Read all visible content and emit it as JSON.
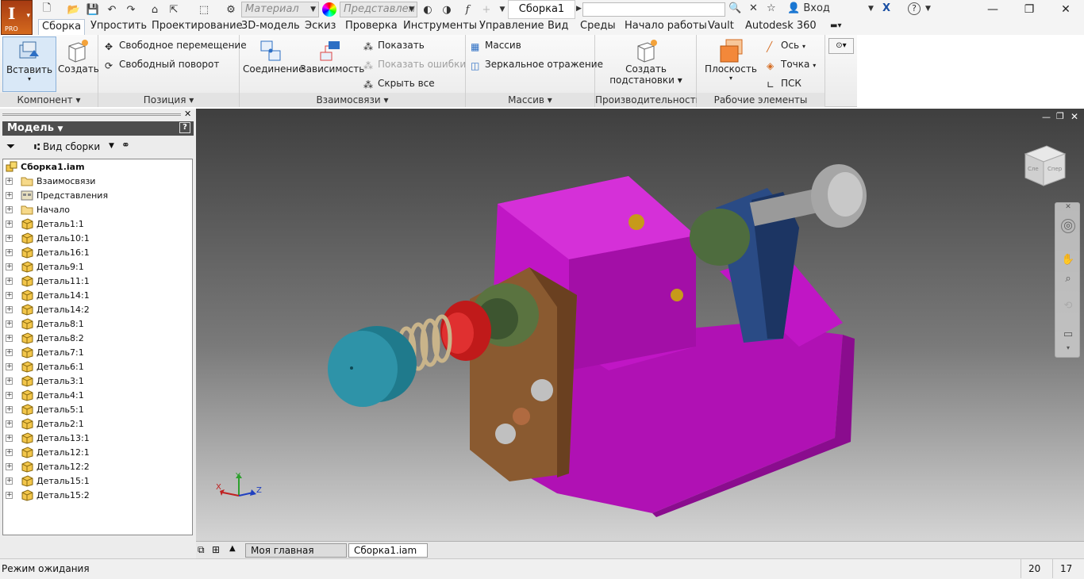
{
  "app": {
    "logo_text": "I",
    "edition": "PRO"
  },
  "qat": {
    "material_placeholder": "Материал",
    "appearance_placeholder": "Представлен",
    "document_title": "Сборка1",
    "sign_in": "Вход",
    "search_value": ""
  },
  "tabs": [
    "Сборка",
    "Упростить",
    "Проектирование",
    "3D-модель",
    "Эскиз",
    "Проверка",
    "Инструменты",
    "Управление",
    "Вид",
    "Среды",
    "Начало работы",
    "Vault",
    "Autodesk 360"
  ],
  "ribbon": {
    "component": {
      "title": "Компонент",
      "insert": "Вставить",
      "create": "Создать"
    },
    "position": {
      "title": "Позиция",
      "free_move": "Свободное перемещение",
      "free_rotate": "Свободный поворот"
    },
    "relations": {
      "title": "Взаимосвязи",
      "joint": "Соединение",
      "constraint": "Зависимость",
      "show": "Показать",
      "show_errors": "Показать ошибки",
      "hide_all": "Скрыть все"
    },
    "pattern": {
      "title": "Массив",
      "pattern": "Массив",
      "mirror": "Зеркальное отражение"
    },
    "productivity": {
      "title": "Производительность",
      "substitutes_line1": "Создать",
      "substitutes_line2": "подстановки"
    },
    "work_features": {
      "title": "Рабочие элементы",
      "plane": "Плоскость",
      "axis": "Ось",
      "point": "Точка",
      "ucs": "ПСК"
    }
  },
  "browser": {
    "title": "Модель",
    "view": "Вид сборки",
    "root": "Сборка1.iam",
    "folders": [
      "Взаимосвязи",
      "Представления",
      "Начало"
    ],
    "parts": [
      "Деталь1:1",
      "Деталь10:1",
      "Деталь16:1",
      "Деталь9:1",
      "Деталь11:1",
      "Деталь14:1",
      "Деталь14:2",
      "Деталь8:1",
      "Деталь8:2",
      "Деталь7:1",
      "Деталь6:1",
      "Деталь3:1",
      "Деталь4:1",
      "Деталь5:1",
      "Деталь2:1",
      "Деталь13:1",
      "Деталь12:1",
      "Деталь12:2",
      "Деталь15:1",
      "Деталь15:2"
    ]
  },
  "viewport": {
    "axis_x": "X",
    "axis_y": "Y",
    "axis_z": "Z",
    "viewcube_left": "Сле",
    "viewcube_front": "Спер"
  },
  "doc_tabs": [
    "Моя главная стран...",
    "Сборка1.iam"
  ],
  "status": {
    "text": "Режим ожидания",
    "count1": "20",
    "count2": "17"
  },
  "colors": {
    "accent": "#d56a1e",
    "part_magenta": "#c014c4",
    "tab_active_border": "#b8c7d8"
  }
}
